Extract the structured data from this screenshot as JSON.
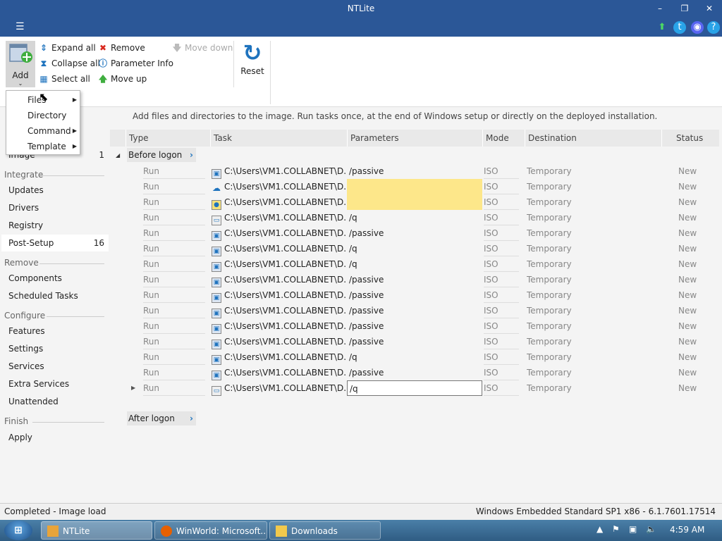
{
  "window": {
    "title": "NTLite"
  },
  "ribbon": {
    "add_label": "Add",
    "expand_all": "Expand all",
    "collapse_all": "Collapse all",
    "select_all": "Select all",
    "remove": "Remove",
    "parameter_info": "Parameter Info",
    "move_up": "Move up",
    "move_down": "Move down",
    "reset": "Reset"
  },
  "dropdown": {
    "items": [
      "Files",
      "Directory",
      "Command",
      "Template"
    ]
  },
  "sidebar": {
    "image_label": "Image",
    "image_count": "1",
    "integrate_header": "Integrate",
    "integrate_items": [
      "Updates",
      "Drivers",
      "Registry",
      "Post-Setup"
    ],
    "post_setup_count": "16",
    "remove_header": "Remove",
    "remove_items": [
      "Components",
      "Scheduled Tasks"
    ],
    "configure_header": "Configure",
    "configure_items": [
      "Features",
      "Settings",
      "Services",
      "Extra Services",
      "Unattended"
    ],
    "finish_header": "Finish",
    "finish_items": [
      "Apply"
    ]
  },
  "main": {
    "info_text": "Add files and directories to the image. Run tasks once, at the end of Windows setup or directly on the deployed installation.",
    "columns": [
      "Type",
      "Task",
      "Parameters",
      "Mode",
      "Destination",
      "Status"
    ],
    "group_before": "Before logon",
    "group_after": "After logon",
    "rows": [
      {
        "type": "Run",
        "task": "C:\\Users\\VM1.COLLABNET\\D...",
        "icon": "installer-icon",
        "params": "/passive",
        "mode": "ISO",
        "dest": "Temporary",
        "status": "New"
      },
      {
        "type": "Run",
        "task": "C:\\Users\\VM1.COLLABNET\\D...",
        "icon": "onedrive-icon",
        "params": "",
        "mode": "ISO",
        "dest": "Temporary",
        "status": "New"
      },
      {
        "type": "Run",
        "task": "C:\\Users\\VM1.COLLABNET\\D...",
        "icon": "package-icon",
        "params": "",
        "mode": "ISO",
        "dest": "Temporary",
        "status": "New"
      },
      {
        "type": "Run",
        "task": "C:\\Users\\VM1.COLLABNET\\D...",
        "icon": "window-icon",
        "params": "/q",
        "mode": "ISO",
        "dest": "Temporary",
        "status": "New"
      },
      {
        "type": "Run",
        "task": "C:\\Users\\VM1.COLLABNET\\D...",
        "icon": "installer-icon",
        "params": "/passive",
        "mode": "ISO",
        "dest": "Temporary",
        "status": "New"
      },
      {
        "type": "Run",
        "task": "C:\\Users\\VM1.COLLABNET\\D...",
        "icon": "installer-icon",
        "params": "/q",
        "mode": "ISO",
        "dest": "Temporary",
        "status": "New"
      },
      {
        "type": "Run",
        "task": "C:\\Users\\VM1.COLLABNET\\D...",
        "icon": "installer-icon",
        "params": "/q",
        "mode": "ISO",
        "dest": "Temporary",
        "status": "New"
      },
      {
        "type": "Run",
        "task": "C:\\Users\\VM1.COLLABNET\\D...",
        "icon": "installer-icon",
        "params": "/passive",
        "mode": "ISO",
        "dest": "Temporary",
        "status": "New"
      },
      {
        "type": "Run",
        "task": "C:\\Users\\VM1.COLLABNET\\D...",
        "icon": "installer-icon",
        "params": "/passive",
        "mode": "ISO",
        "dest": "Temporary",
        "status": "New"
      },
      {
        "type": "Run",
        "task": "C:\\Users\\VM1.COLLABNET\\D...",
        "icon": "installer-icon",
        "params": "/passive",
        "mode": "ISO",
        "dest": "Temporary",
        "status": "New"
      },
      {
        "type": "Run",
        "task": "C:\\Users\\VM1.COLLABNET\\D...",
        "icon": "installer-icon",
        "params": "/passive",
        "mode": "ISO",
        "dest": "Temporary",
        "status": "New"
      },
      {
        "type": "Run",
        "task": "C:\\Users\\VM1.COLLABNET\\D...",
        "icon": "installer-icon",
        "params": "/passive",
        "mode": "ISO",
        "dest": "Temporary",
        "status": "New"
      },
      {
        "type": "Run",
        "task": "C:\\Users\\VM1.COLLABNET\\D...",
        "icon": "installer-icon",
        "params": "/q",
        "mode": "ISO",
        "dest": "Temporary",
        "status": "New"
      },
      {
        "type": "Run",
        "task": "C:\\Users\\VM1.COLLABNET\\D...",
        "icon": "installer-icon",
        "params": "/passive",
        "mode": "ISO",
        "dest": "Temporary",
        "status": "New"
      },
      {
        "type": "Run",
        "task": "C:\\Users\\VM1.COLLABNET\\D...",
        "icon": "window-icon",
        "params": "/q",
        "mode": "ISO",
        "dest": "Temporary",
        "status": "New"
      }
    ]
  },
  "statusbar": {
    "left": "Completed - Image load",
    "right": "Windows Embedded Standard SP1 x86 - 6.1.7601.17514"
  },
  "taskbar": {
    "items": [
      "NTLite",
      "WinWorld: Microsoft...",
      "Downloads"
    ],
    "clock": "4:59 AM"
  },
  "colors": {
    "titlebar": "#2b5797",
    "accent": "#1e73be",
    "highlight_yellow": "#fde78a"
  }
}
